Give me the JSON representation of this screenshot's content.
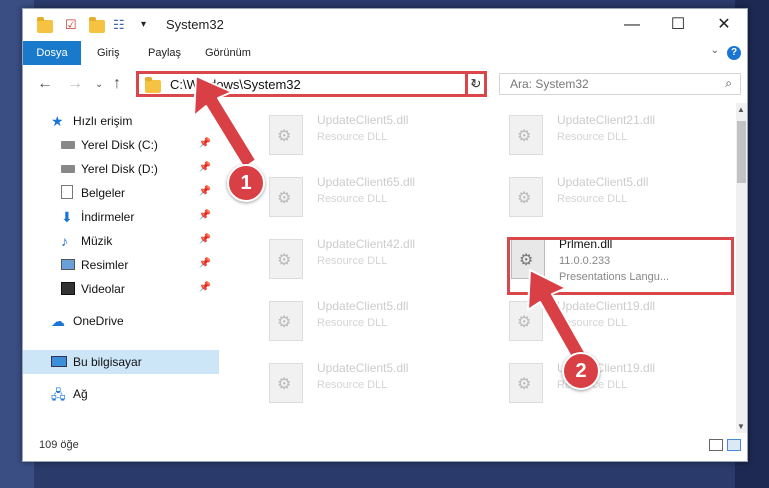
{
  "window": {
    "title": "System32"
  },
  "menu": {
    "file": "Dosya",
    "home": "Giriş",
    "share": "Paylaş",
    "view": "Görünüm",
    "help": "?"
  },
  "nav": {
    "address": "C:\\Windows\\System32",
    "search_placeholder": "Ara: System32"
  },
  "sidebar": {
    "items": [
      {
        "label": "Hızlı erişim",
        "icon": "star-icon"
      },
      {
        "label": "Yerel Disk (C:)",
        "icon": "drive-icon",
        "pinned": true
      },
      {
        "label": "Yerel Disk (D:)",
        "icon": "drive-icon",
        "pinned": true
      },
      {
        "label": "Belgeler",
        "icon": "documents-icon",
        "pinned": true
      },
      {
        "label": "İndirmeler",
        "icon": "downloads-icon",
        "pinned": true
      },
      {
        "label": "Müzik",
        "icon": "music-icon",
        "pinned": true
      },
      {
        "label": "Resimler",
        "icon": "pictures-icon",
        "pinned": true
      },
      {
        "label": "Videolar",
        "icon": "videos-icon",
        "pinned": true
      },
      {
        "label": "OneDrive",
        "icon": "cloud-icon"
      },
      {
        "label": "Bu bilgisayar",
        "icon": "computer-icon",
        "selected": true
      },
      {
        "label": "Ağ",
        "icon": "network-icon"
      }
    ]
  },
  "files": [
    {
      "name": "UpdateClient5.dll",
      "sub": "Resource DLL"
    },
    {
      "name": "UpdateClient21.dll",
      "sub": "Resource DLL"
    },
    {
      "name": "UpdateClient65.dll",
      "sub": "Resource DLL"
    },
    {
      "name": "UpdateClient5.dll",
      "sub": "Resource DLL"
    },
    {
      "name": "UpdateClient42.dll",
      "sub": "Resource DLL"
    },
    {
      "name": "Prlmen.dll",
      "sub": "11.0.0.233",
      "sub2": "Presentations Langu...",
      "highlighted": true
    },
    {
      "name": "UpdateClient5.dll",
      "sub": "Resource DLL"
    },
    {
      "name": "UpdateClient19.dll",
      "sub": "Resource DLL"
    },
    {
      "name": "UpdateClient5.dll",
      "sub": "Resource DLL"
    },
    {
      "name": "UpdateClient19.dll",
      "sub": "Resource DLL"
    }
  ],
  "status": {
    "count": "109 öğe"
  },
  "annotations": {
    "step1": "1",
    "step2": "2"
  },
  "colors": {
    "accent": "#1979ca",
    "highlight": "#d9474b",
    "selected": "#cce5f7"
  }
}
